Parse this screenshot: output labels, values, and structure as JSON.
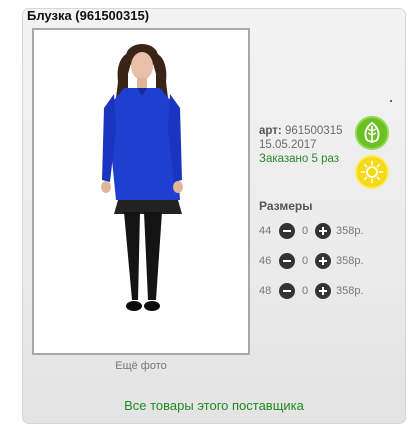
{
  "product": {
    "title": "Блузка (961500315)",
    "more_photo_label": "Ещё фото",
    "art_label": "арт:",
    "art_value": "961500315",
    "date": "15.05.2017",
    "ordered_text": "Заказано 5 раз"
  },
  "badges": {
    "eco_icon": "leaf-icon",
    "summer_icon": "sun-icon",
    "eco_color": "#6cc025",
    "summer_color": "#f5da17"
  },
  "sizes": {
    "heading": "Размеры",
    "rows": [
      {
        "size": "44",
        "qty": "0",
        "price": "358р."
      },
      {
        "size": "46",
        "qty": "0",
        "price": "358р."
      },
      {
        "size": "48",
        "qty": "0",
        "price": "358р."
      }
    ]
  },
  "footer": {
    "supplier_link": "Все товары этого поставщика",
    "link_color": "#1f8b1f"
  }
}
